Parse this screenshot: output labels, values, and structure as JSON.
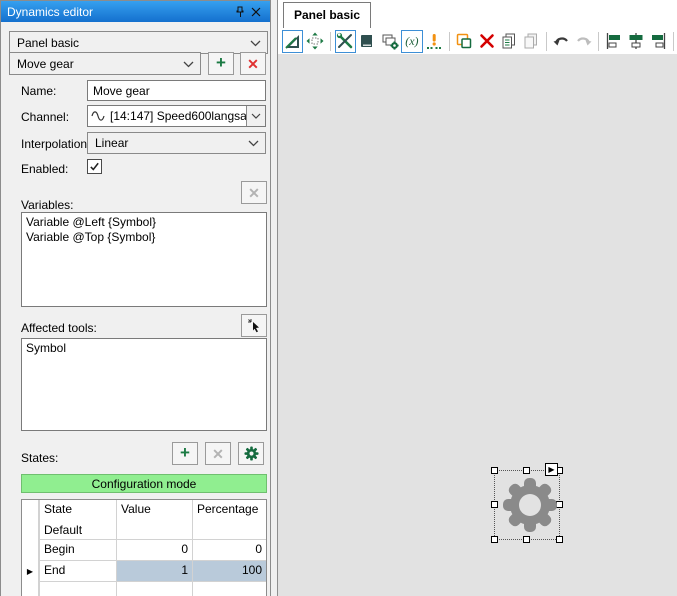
{
  "colors": {
    "titlebar_top": "#36A0EF",
    "titlebar_bottom": "#1470CE",
    "panel_bg": "#F0F0F0",
    "canvas_bg": "#E2E2E2",
    "toggle_border": "#3D8FD6",
    "config_green": "#90EE90",
    "selected_cell": "#B9CADA",
    "gear_gray": "#8A8A8A",
    "add_green": "#1B7A43",
    "delete_red": "#E03131"
  },
  "dynamics_editor": {
    "title": "Dynamics editor",
    "titlebar_icons": [
      "pin-icon",
      "close-icon"
    ],
    "panel_selector_value": "Panel basic",
    "dynamic_selector_value": "Move gear",
    "fields": {
      "name_label": "Name:",
      "name_value": "Move gear",
      "channel_label": "Channel:",
      "channel_value": "[14:147] Speed600langsa",
      "channel_icon": "sine-wave-icon",
      "interpolation_label": "Interpolation:",
      "interpolation_value": "Linear",
      "enabled_label": "Enabled:",
      "enabled_checked": true
    },
    "variables": {
      "label": "Variables:",
      "items": [
        "Variable @Left {Symbol}",
        "Variable @Top {Symbol}"
      ]
    },
    "affected_tools": {
      "label": "Affected tools:",
      "items": [
        "Symbol"
      ]
    },
    "states": {
      "label": "States:",
      "buttons": [
        "add-state-button",
        "delete-state-button",
        "state-settings-button"
      ],
      "config_button_label": "Configuration mode",
      "table": {
        "columns": [
          "State",
          "Value",
          "Percentage"
        ],
        "rows": [
          {
            "state": "Default",
            "value": "",
            "percentage": "",
            "selected": false
          },
          {
            "state": "Begin",
            "value": "0",
            "percentage": "0",
            "selected": false
          },
          {
            "state": "End",
            "value": "1",
            "percentage": "100",
            "selected": true
          }
        ],
        "selected_row_marker": "▶"
      }
    }
  },
  "workarea": {
    "tab_label": "Panel basic",
    "toolbar_icons": [
      "design-mode-icon (toggled)",
      "move-tool-icon",
      "separator",
      "tools-icon (toggled)",
      "book-icon",
      "panels-settings-icon",
      "function-x-icon (toggled)",
      "set-value-icon",
      "separator",
      "overlap-squares-icon",
      "delete-icon",
      "copy-icon",
      "paste-icon (disabled)",
      "separator",
      "undo-icon",
      "redo-icon (disabled)",
      "separator",
      "align-left-icon",
      "align-center-icon",
      "align-right-icon"
    ],
    "canvas_selected_object": "gear-symbol",
    "play_tag": "▶"
  }
}
